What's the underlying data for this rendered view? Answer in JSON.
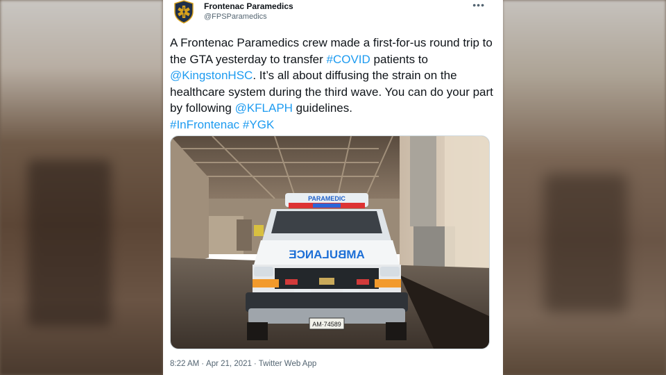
{
  "account": {
    "name": "Frontenac Paramedics",
    "handle": "@FPSParamedics"
  },
  "tweet": {
    "t1": "A Frontenac Paramedics crew made a first-for-us round trip to the GTA yesterday to transfer ",
    "covid": "#COVID",
    "t2": " patients to ",
    "kingston": "@KingstonHSC",
    "t3": ". It’s all about diffusing the strain on the healthcare system during the third wave. You can do your part by following ",
    "kflaph": "@KFLAPH",
    "t4": " guidelines.",
    "infrontenac": "#InFrontenac",
    "ygk": "#YGK"
  },
  "photo": {
    "roof_sign": "PARAMEDIC",
    "hood_text": "AMBULANCE",
    "plate": "AM·74589"
  },
  "meta": {
    "time": "8:22 AM",
    "date": "Apr 21, 2021",
    "source": "Twitter Web App",
    "sep": "·"
  },
  "colors": {
    "link": "#1d9bf0",
    "text": "#0f1419",
    "muted": "#536471",
    "badge_navy": "#1f2f4a",
    "badge_gold": "#d9a21b"
  },
  "icons": {
    "avatar": "star-of-life-badge-icon",
    "more": "more-dots-icon"
  }
}
